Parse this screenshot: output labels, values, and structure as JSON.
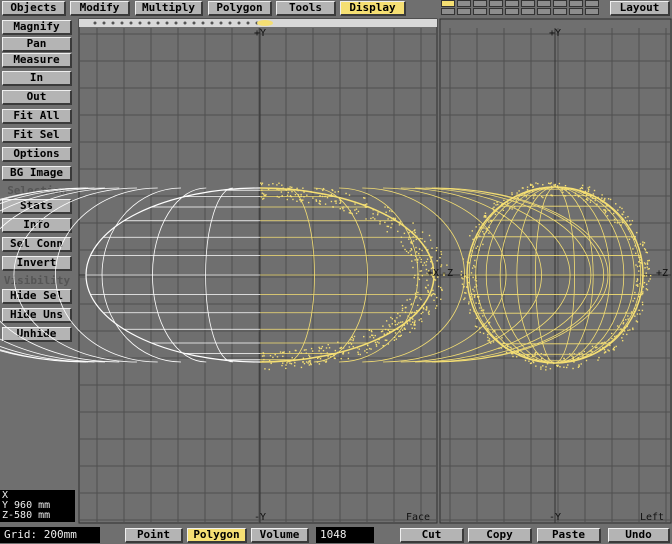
{
  "top_tabs": [
    {
      "label": "Objects",
      "active": false
    },
    {
      "label": "Modify",
      "active": false
    },
    {
      "label": "Multiply",
      "active": false
    },
    {
      "label": "Polygon",
      "active": false
    },
    {
      "label": "Tools",
      "active": false
    },
    {
      "label": "Display",
      "active": true
    }
  ],
  "layout_button": "Layout",
  "side_tools": [
    "Magnify",
    "Pan",
    "Measure",
    "In",
    "Out",
    "Fit All",
    "Fit Sel",
    "Options",
    "BG Image"
  ],
  "selection_header": "Selection",
  "selection_tools": [
    "Stats",
    "Info",
    "Sel Conn",
    "Invert"
  ],
  "visibility_header": "Visibility",
  "visibility_tools": [
    "Hide Sel",
    "Hide Uns",
    "Unhide"
  ],
  "coords": {
    "x": "X",
    "y": "Y 960  mm",
    "z": "Z-580  mm"
  },
  "grid_label": "Grid: 200mm",
  "mode_buttons": [
    {
      "label": "Point",
      "active": false
    },
    {
      "label": "Polygon",
      "active": true
    },
    {
      "label": "Volume",
      "active": false
    }
  ],
  "poly_count": "1048",
  "edit_buttons": [
    "Cut",
    "Copy",
    "Paste",
    "Undo"
  ],
  "viewports": {
    "face": {
      "name": "Face",
      "axis_top": "+Y",
      "axis_bottom": "-Y",
      "axis_right": "+X"
    },
    "left": {
      "name": "Left",
      "axis_top": "+Y",
      "axis_bottom": "-Y",
      "axis_left": "-Z",
      "axis_right": "+Z"
    }
  },
  "colors": {
    "background": "#6f6f6f",
    "button": "#b4b4b4",
    "active": "#f5df73",
    "selected_mesh": "#f5df73",
    "mesh": "#ffffff",
    "grid": "#4f4f4f"
  }
}
